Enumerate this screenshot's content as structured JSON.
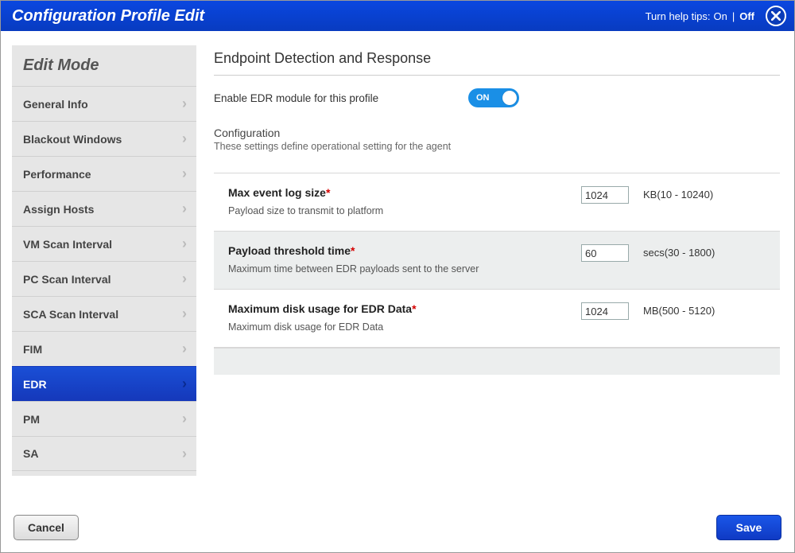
{
  "window": {
    "title": "Configuration Profile Edit"
  },
  "helpTips": {
    "label": "Turn help tips:",
    "on": "On",
    "off": "Off",
    "selected": "Off"
  },
  "sidebar": {
    "title": "Edit Mode",
    "items": [
      {
        "label": "General Info"
      },
      {
        "label": "Blackout Windows"
      },
      {
        "label": "Performance"
      },
      {
        "label": "Assign Hosts"
      },
      {
        "label": "VM Scan Interval"
      },
      {
        "label": "PC Scan Interval"
      },
      {
        "label": "SCA Scan Interval"
      },
      {
        "label": "FIM"
      },
      {
        "label": "EDR",
        "active": true
      },
      {
        "label": "PM"
      },
      {
        "label": "SA"
      }
    ]
  },
  "main": {
    "heading": "Endpoint Detection and Response",
    "enable_label": "Enable EDR module for this profile",
    "toggle_text": "ON",
    "config_title": "Configuration",
    "config_desc": "These settings define operational setting for the agent",
    "rows": [
      {
        "label": "Max event log size",
        "desc": "Payload size to transmit to platform",
        "value": "1024",
        "unit": "KB(10 - 10240)"
      },
      {
        "label": "Payload threshold time",
        "desc": "Maximum time between EDR payloads sent to the server",
        "value": "60",
        "unit": "secs(30 - 1800)"
      },
      {
        "label": "Maximum disk usage for EDR Data",
        "desc": "Maximum disk usage for EDR Data",
        "value": "1024",
        "unit": "MB(500 - 5120)"
      }
    ]
  },
  "footer": {
    "cancel": "Cancel",
    "save": "Save"
  }
}
